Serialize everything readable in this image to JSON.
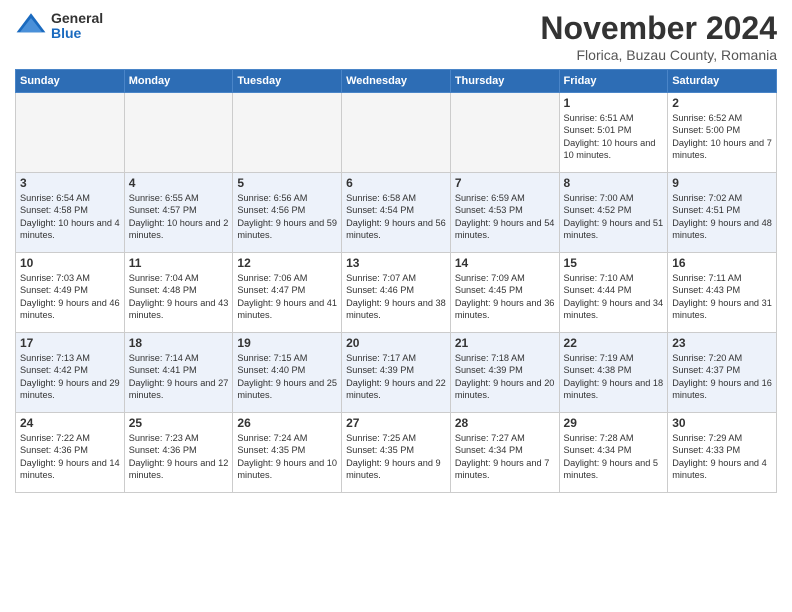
{
  "header": {
    "logo_general": "General",
    "logo_blue": "Blue",
    "month_title": "November 2024",
    "subtitle": "Florica, Buzau County, Romania"
  },
  "days_of_week": [
    "Sunday",
    "Monday",
    "Tuesday",
    "Wednesday",
    "Thursday",
    "Friday",
    "Saturday"
  ],
  "weeks": [
    [
      {
        "day": "",
        "info": "",
        "empty": true
      },
      {
        "day": "",
        "info": "",
        "empty": true
      },
      {
        "day": "",
        "info": "",
        "empty": true
      },
      {
        "day": "",
        "info": "",
        "empty": true
      },
      {
        "day": "",
        "info": "",
        "empty": true
      },
      {
        "day": "1",
        "info": "Sunrise: 6:51 AM\nSunset: 5:01 PM\nDaylight: 10 hours and 10 minutes."
      },
      {
        "day": "2",
        "info": "Sunrise: 6:52 AM\nSunset: 5:00 PM\nDaylight: 10 hours and 7 minutes."
      }
    ],
    [
      {
        "day": "3",
        "info": "Sunrise: 6:54 AM\nSunset: 4:58 PM\nDaylight: 10 hours and 4 minutes."
      },
      {
        "day": "4",
        "info": "Sunrise: 6:55 AM\nSunset: 4:57 PM\nDaylight: 10 hours and 2 minutes."
      },
      {
        "day": "5",
        "info": "Sunrise: 6:56 AM\nSunset: 4:56 PM\nDaylight: 9 hours and 59 minutes."
      },
      {
        "day": "6",
        "info": "Sunrise: 6:58 AM\nSunset: 4:54 PM\nDaylight: 9 hours and 56 minutes."
      },
      {
        "day": "7",
        "info": "Sunrise: 6:59 AM\nSunset: 4:53 PM\nDaylight: 9 hours and 54 minutes."
      },
      {
        "day": "8",
        "info": "Sunrise: 7:00 AM\nSunset: 4:52 PM\nDaylight: 9 hours and 51 minutes."
      },
      {
        "day": "9",
        "info": "Sunrise: 7:02 AM\nSunset: 4:51 PM\nDaylight: 9 hours and 48 minutes."
      }
    ],
    [
      {
        "day": "10",
        "info": "Sunrise: 7:03 AM\nSunset: 4:49 PM\nDaylight: 9 hours and 46 minutes."
      },
      {
        "day": "11",
        "info": "Sunrise: 7:04 AM\nSunset: 4:48 PM\nDaylight: 9 hours and 43 minutes."
      },
      {
        "day": "12",
        "info": "Sunrise: 7:06 AM\nSunset: 4:47 PM\nDaylight: 9 hours and 41 minutes."
      },
      {
        "day": "13",
        "info": "Sunrise: 7:07 AM\nSunset: 4:46 PM\nDaylight: 9 hours and 38 minutes."
      },
      {
        "day": "14",
        "info": "Sunrise: 7:09 AM\nSunset: 4:45 PM\nDaylight: 9 hours and 36 minutes."
      },
      {
        "day": "15",
        "info": "Sunrise: 7:10 AM\nSunset: 4:44 PM\nDaylight: 9 hours and 34 minutes."
      },
      {
        "day": "16",
        "info": "Sunrise: 7:11 AM\nSunset: 4:43 PM\nDaylight: 9 hours and 31 minutes."
      }
    ],
    [
      {
        "day": "17",
        "info": "Sunrise: 7:13 AM\nSunset: 4:42 PM\nDaylight: 9 hours and 29 minutes."
      },
      {
        "day": "18",
        "info": "Sunrise: 7:14 AM\nSunset: 4:41 PM\nDaylight: 9 hours and 27 minutes."
      },
      {
        "day": "19",
        "info": "Sunrise: 7:15 AM\nSunset: 4:40 PM\nDaylight: 9 hours and 25 minutes."
      },
      {
        "day": "20",
        "info": "Sunrise: 7:17 AM\nSunset: 4:39 PM\nDaylight: 9 hours and 22 minutes."
      },
      {
        "day": "21",
        "info": "Sunrise: 7:18 AM\nSunset: 4:39 PM\nDaylight: 9 hours and 20 minutes."
      },
      {
        "day": "22",
        "info": "Sunrise: 7:19 AM\nSunset: 4:38 PM\nDaylight: 9 hours and 18 minutes."
      },
      {
        "day": "23",
        "info": "Sunrise: 7:20 AM\nSunset: 4:37 PM\nDaylight: 9 hours and 16 minutes."
      }
    ],
    [
      {
        "day": "24",
        "info": "Sunrise: 7:22 AM\nSunset: 4:36 PM\nDaylight: 9 hours and 14 minutes."
      },
      {
        "day": "25",
        "info": "Sunrise: 7:23 AM\nSunset: 4:36 PM\nDaylight: 9 hours and 12 minutes."
      },
      {
        "day": "26",
        "info": "Sunrise: 7:24 AM\nSunset: 4:35 PM\nDaylight: 9 hours and 10 minutes."
      },
      {
        "day": "27",
        "info": "Sunrise: 7:25 AM\nSunset: 4:35 PM\nDaylight: 9 hours and 9 minutes."
      },
      {
        "day": "28",
        "info": "Sunrise: 7:27 AM\nSunset: 4:34 PM\nDaylight: 9 hours and 7 minutes."
      },
      {
        "day": "29",
        "info": "Sunrise: 7:28 AM\nSunset: 4:34 PM\nDaylight: 9 hours and 5 minutes."
      },
      {
        "day": "30",
        "info": "Sunrise: 7:29 AM\nSunset: 4:33 PM\nDaylight: 9 hours and 4 minutes."
      }
    ]
  ]
}
